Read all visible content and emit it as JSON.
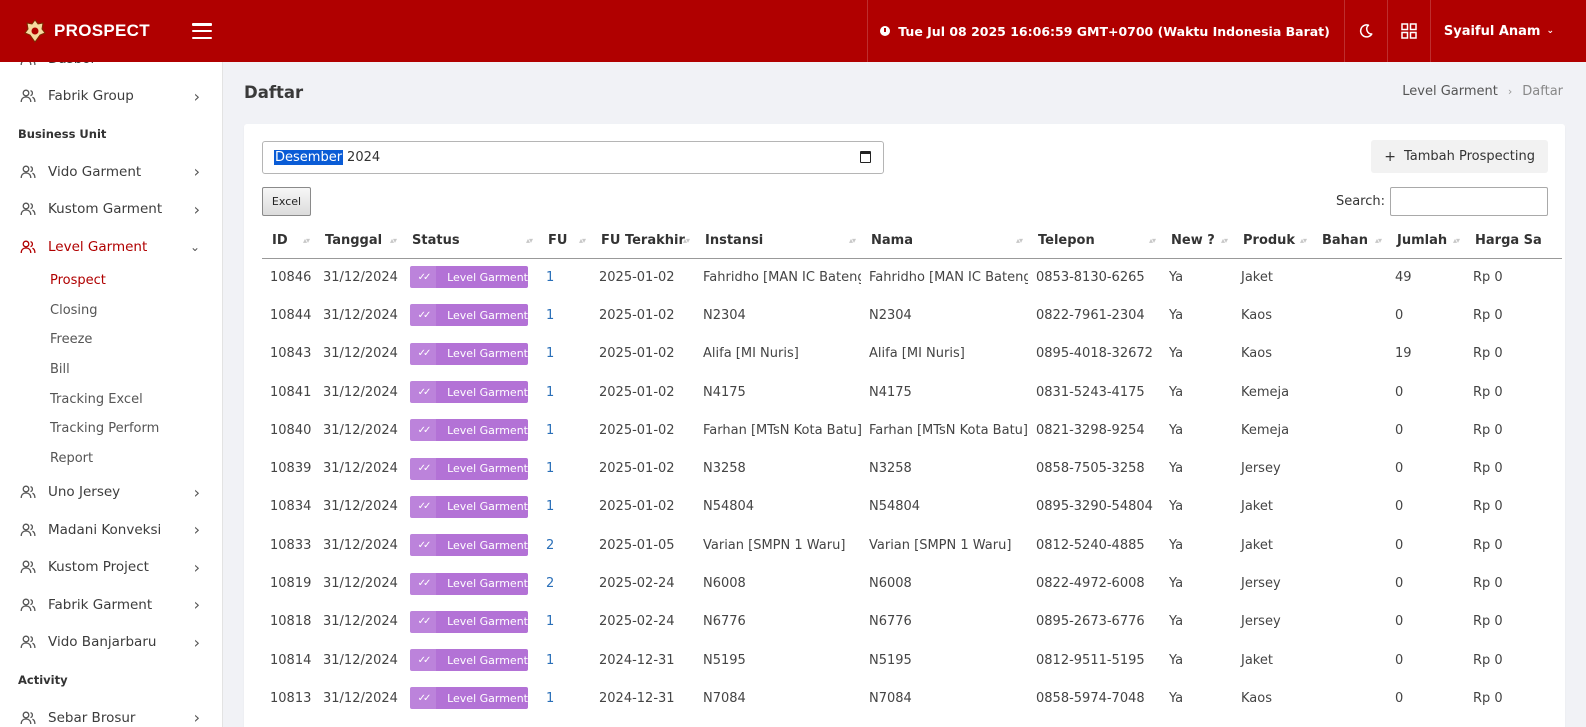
{
  "app": {
    "name": "PROSPECT"
  },
  "topbar": {
    "datetime": "Tue Jul 08 2025 16:06:59 GMT+0700 (Waktu Indonesia Barat)",
    "user": "Syaiful Anam"
  },
  "sidebar": {
    "partial_top": "Dasbor",
    "fabrik_group": "Fabrik Group",
    "section_business": "Business Unit",
    "items_before": [
      "Vido Garment",
      "Kustom Garment"
    ],
    "active_parent": "Level Garment",
    "subitems": [
      "Prospect",
      "Closing",
      "Freeze",
      "Bill",
      "Tracking Excel",
      "Tracking Perform",
      "Report"
    ],
    "items_after": [
      "Uno Jersey",
      "Madani Konveksi",
      "Kustom Project",
      "Fabrik Garment",
      "Vido Banjarbaru"
    ],
    "section_activity": "Activity",
    "partial_bottom": "Sebar Brosur"
  },
  "page": {
    "title": "Daftar",
    "breadcrumb": [
      "Level Garment",
      "Daftar"
    ]
  },
  "filter": {
    "month_selected": "Desember",
    "year": "2024"
  },
  "buttons": {
    "add": "Tambah Prospecting",
    "excel": "Excel"
  },
  "search": {
    "label": "Search:",
    "value": ""
  },
  "table": {
    "columns": [
      "ID",
      "Tanggal",
      "Status",
      "FU",
      "FU Terakhir",
      "Instansi",
      "Nama",
      "Telepon",
      "New ?",
      "Produk",
      "Bahan",
      "Jumlah",
      "Harga Sa"
    ],
    "rows": [
      [
        "10846",
        "31/12/2024",
        "Level Garment",
        "1",
        "2025-01-02",
        "Fahridho [MAN IC Bateng]",
        "Fahridho [MAN IC Bateng]",
        "0853-8130-6265",
        "Ya",
        "Jaket",
        "",
        "49",
        "Rp 0"
      ],
      [
        "10844",
        "31/12/2024",
        "Level Garment",
        "1",
        "2025-01-02",
        "N2304",
        "N2304",
        "0822-7961-2304",
        "Ya",
        "Kaos",
        "",
        "0",
        "Rp 0"
      ],
      [
        "10843",
        "31/12/2024",
        "Level Garment",
        "1",
        "2025-01-02",
        "Alifa [MI Nuris]",
        "Alifa [MI Nuris]",
        "0895-4018-32672",
        "Ya",
        "Kaos",
        "",
        "19",
        "Rp 0"
      ],
      [
        "10841",
        "31/12/2024",
        "Level Garment",
        "1",
        "2025-01-02",
        "N4175",
        "N4175",
        "0831-5243-4175",
        "Ya",
        "Kemeja",
        "",
        "0",
        "Rp 0"
      ],
      [
        "10840",
        "31/12/2024",
        "Level Garment",
        "1",
        "2025-01-02",
        "Farhan [MTsN Kota Batu]",
        "Farhan [MTsN Kota Batu]",
        "0821-3298-9254",
        "Ya",
        "Kemeja",
        "",
        "0",
        "Rp 0"
      ],
      [
        "10839",
        "31/12/2024",
        "Level Garment",
        "1",
        "2025-01-02",
        "N3258",
        "N3258",
        "0858-7505-3258",
        "Ya",
        "Jersey",
        "",
        "0",
        "Rp 0"
      ],
      [
        "10834",
        "31/12/2024",
        "Level Garment",
        "1",
        "2025-01-02",
        "N54804",
        "N54804",
        "0895-3290-54804",
        "Ya",
        "Jaket",
        "",
        "0",
        "Rp 0"
      ],
      [
        "10833",
        "31/12/2024",
        "Level Garment",
        "2",
        "2025-01-05",
        "Varian [SMPN 1 Waru]",
        "Varian [SMPN 1 Waru]",
        "0812-5240-4885",
        "Ya",
        "Jaket",
        "",
        "0",
        "Rp 0"
      ],
      [
        "10819",
        "31/12/2024",
        "Level Garment",
        "2",
        "2025-02-24",
        "N6008",
        "N6008",
        "0822-4972-6008",
        "Ya",
        "Jersey",
        "",
        "0",
        "Rp 0"
      ],
      [
        "10818",
        "31/12/2024",
        "Level Garment",
        "1",
        "2025-02-24",
        "N6776",
        "N6776",
        "0895-2673-6776",
        "Ya",
        "Jersey",
        "",
        "0",
        "Rp 0"
      ],
      [
        "10814",
        "31/12/2024",
        "Level Garment",
        "1",
        "2024-12-31",
        "N5195",
        "N5195",
        "0812-9511-5195",
        "Ya",
        "Jaket",
        "",
        "0",
        "Rp 0"
      ],
      [
        "10813",
        "31/12/2024",
        "Level Garment",
        "1",
        "2024-12-31",
        "N7084",
        "N7084",
        "0858-5974-7048",
        "Ya",
        "Kaos",
        "",
        "0",
        "Rp 0"
      ]
    ]
  },
  "colors": {
    "brand": "#b00000",
    "status_badge": "#b372d6",
    "link": "#2a6fb8"
  },
  "icons": [
    "logo-icon",
    "hamburger-icon",
    "clock-icon",
    "moon-icon",
    "grid-icon",
    "chevron-down-icon",
    "users-icon",
    "chevron-right-icon",
    "calendar-icon",
    "plus-icon",
    "check-icon",
    "sort-icon"
  ]
}
